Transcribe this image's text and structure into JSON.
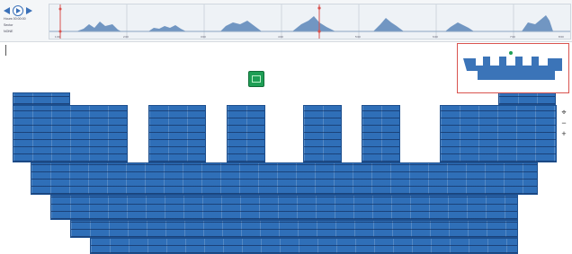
{
  "controls": {
    "prev_icon": "skip-back-icon",
    "play_icon": "play-icon",
    "next_icon": "skip-forward-icon",
    "info_lines": [
      "Hours 00:00:00",
      "Sector",
      "NONE"
    ]
  },
  "timeline": {
    "tick_labels": [
      "1:00",
      "2:00",
      "3:00",
      "4:00",
      "5:00",
      "6:00",
      "7:00",
      "8:00"
    ],
    "range_start_marker": "range-start-handle",
    "range_current_marker": "playhead-handle",
    "color_fill": "#5b86b8",
    "color_marker": "#d9534f"
  },
  "map": {
    "seat_color": "#2f6fb8",
    "pitch_color": "#1e9e55"
  },
  "zoom": {
    "reset_icon": "crosshair-icon",
    "zoom_out_label": "−",
    "zoom_in_label": "+"
  }
}
